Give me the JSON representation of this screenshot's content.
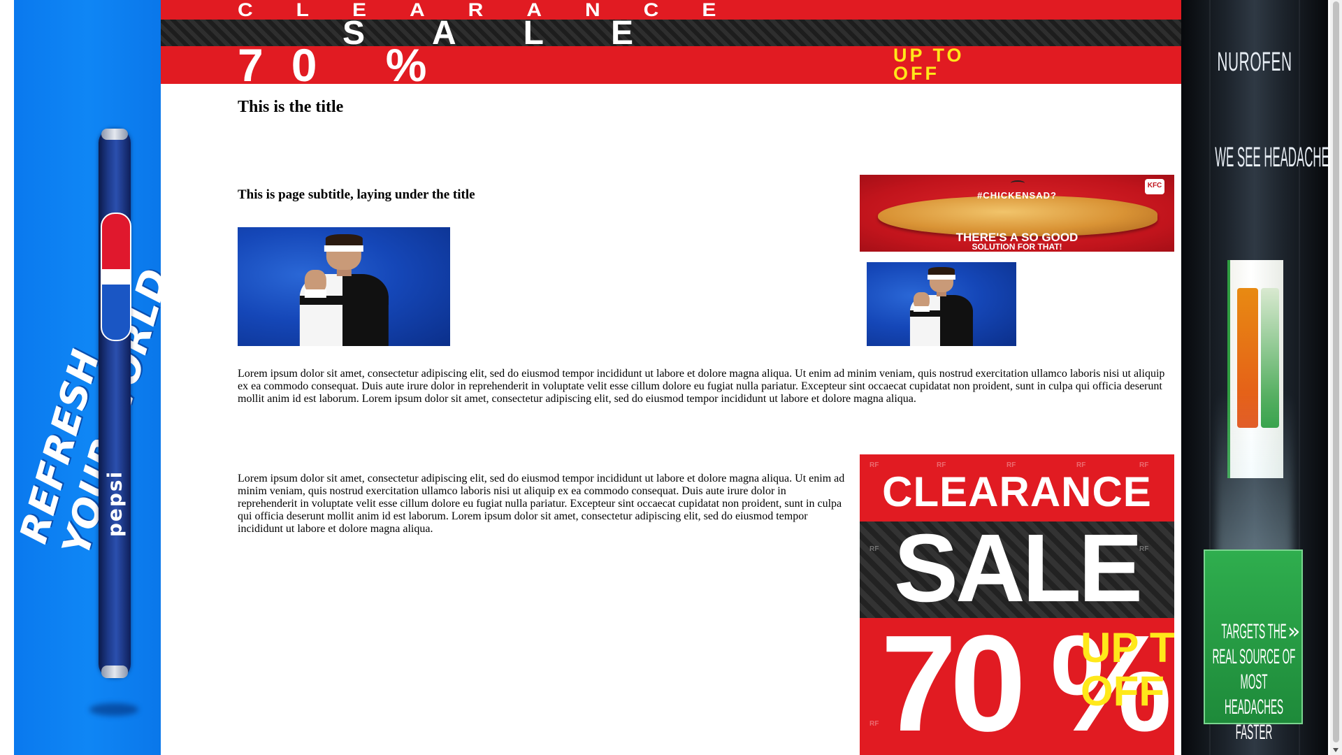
{
  "page": {
    "title": "This is the title",
    "subtitle": "This is page subtitle, laying under the title",
    "paragraph_1": "Lorem ipsum dolor sit amet, consectetur adipiscing elit, sed do eiusmod tempor incididunt ut labore et dolore magna aliqua. Ut enim ad minim veniam, quis nostrud exercitation ullamco laboris nisi ut aliquip ex ea commodo consequat. Duis aute irure dolor in reprehenderit in voluptate velit esse cillum dolore eu fugiat nulla pariatur. Excepteur sint occaecat cupidatat non proident, sunt in culpa qui officia deserunt mollit anim id est laborum. Lorem ipsum dolor sit amet, consectetur adipiscing elit, sed do eiusmod tempor incididunt ut labore et dolore magna aliqua.",
    "paragraph_2": "Lorem ipsum dolor sit amet, consectetur adipiscing elit, sed do eiusmod tempor incididunt ut labore et dolore magna aliqua. Ut enim ad minim veniam, quis nostrud exercitation ullamco laboris nisi ut aliquip ex ea commodo consequat. Duis aute irure dolor in reprehenderit in voluptate velit esse cillum dolore eu fugiat nulla pariatur. Excepteur sint occaecat cupidatat non proident, sunt in culpa qui officia deserunt mollit anim id est laborum. Lorem ipsum dolor sit amet, consectetur adipiscing elit, sed do eiusmod tempor incididunt ut labore et dolore magna aliqua."
  },
  "ads": {
    "top_banner": {
      "line1": "CLEARANCE",
      "line2": "SALE",
      "percent": "70 %",
      "up_to": "UP TO",
      "off": "OFF"
    },
    "left_skyscraper": {
      "slogan": "REFRESH YOUR WORLD",
      "brand": "pepsi"
    },
    "right_skyscraper": {
      "brand": "NUROFEN",
      "tagline": "WE SEE HEADACHES DIFFERENTLY",
      "claim": "TARGETS THE REAL SOURCE OF MOST HEADACHES FASTER",
      "chevron": "»"
    },
    "kfc_banner": {
      "hashtag": "#CHICKENSAD?",
      "line1": "THERE'S A SO GOOD",
      "line2": "SOLUTION FOR THAT!",
      "logo": "KFC"
    },
    "clearance_box": {
      "line1": "CLEARANCE",
      "line2": "SALE",
      "percent": "70 %",
      "up_to": "UP TO",
      "off": "OFF",
      "watermark": "RF"
    }
  },
  "colors": {
    "sale_red": "#e11b22",
    "sale_yellow": "#ffe81a",
    "pepsi_blue": "#0f86f5",
    "photo_blue": "#1547b8"
  }
}
